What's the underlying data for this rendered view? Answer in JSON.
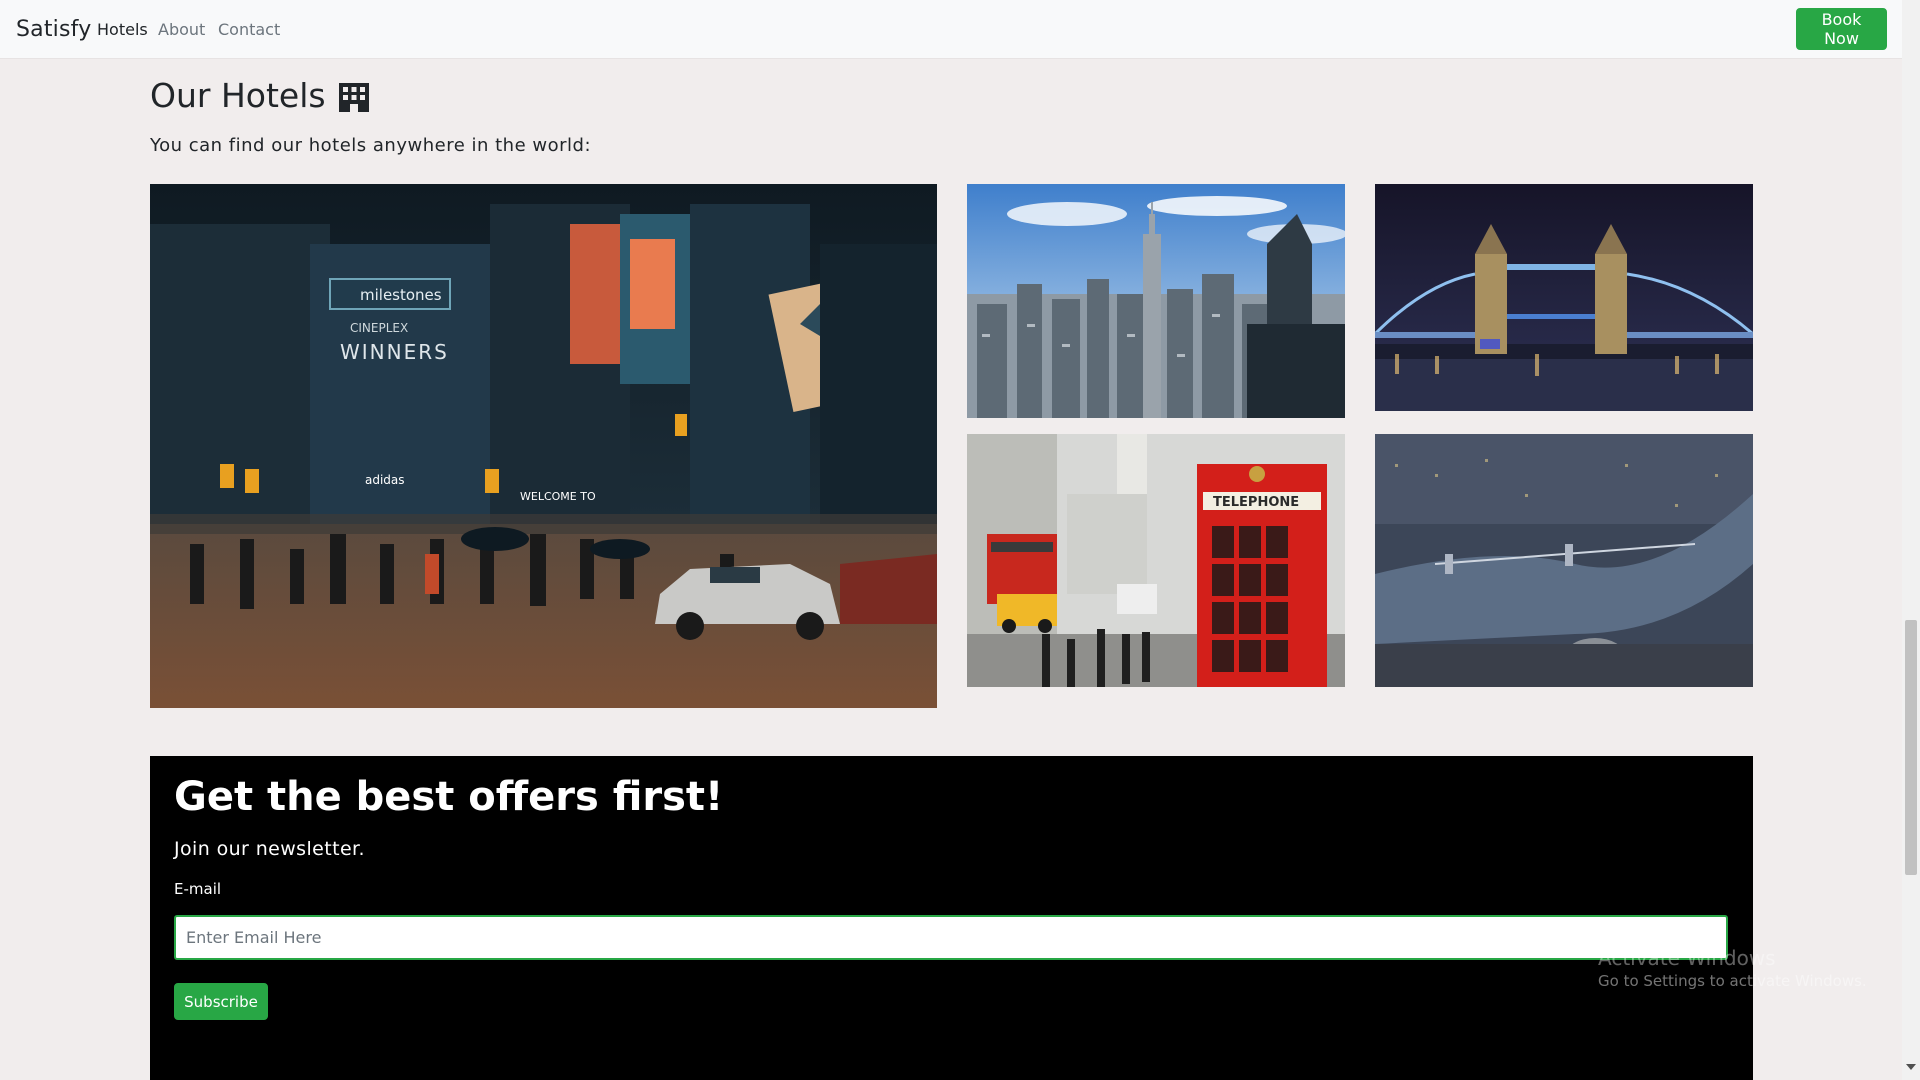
{
  "navbar": {
    "brand": "Satisfy",
    "links": [
      {
        "label": "Hotels",
        "active": true
      },
      {
        "label": "About",
        "active": false
      },
      {
        "label": "Contact",
        "active": false
      }
    ],
    "book_label": "Book Now"
  },
  "hotels": {
    "title": "Our Hotels",
    "subtitle": "You can find our hotels anywhere in the world:",
    "icon": "building-icon",
    "photos": [
      {
        "name": "city-street-photo",
        "sign_1": "milestones",
        "sign_2": "WINNERS",
        "sign_3": "CINEPLEX",
        "sign_4": "adidas",
        "sign_5": "WELCOME TO"
      },
      {
        "name": "new-york-skyline-photo"
      },
      {
        "name": "tower-bridge-night-photo"
      },
      {
        "name": "london-phone-booth-photo",
        "sign": "TELEPHONE"
      },
      {
        "name": "london-aerial-photo"
      }
    ]
  },
  "newsletter": {
    "title": "Get the best offers first!",
    "subtitle": "Join our newsletter.",
    "email_label": "E-mail",
    "email_placeholder": "Enter Email Here",
    "email_value": "",
    "subscribe_label": "Subscribe"
  },
  "watermark": {
    "line1": "Activate Windows",
    "line2": "Go to Settings to activate Windows."
  },
  "colors": {
    "accent": "#28a745",
    "page_bg": "#f1eded",
    "navbar_bg": "#f8f9fa",
    "newsletter_bg": "#000000"
  }
}
